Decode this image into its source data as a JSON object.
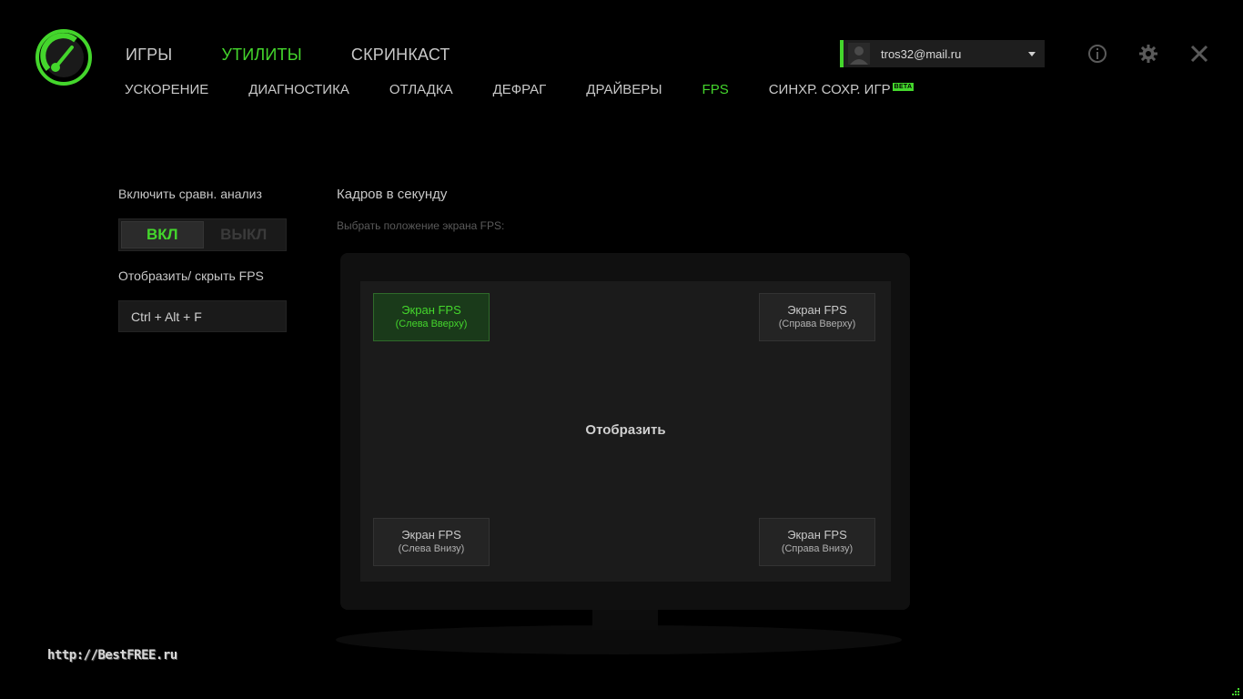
{
  "main_nav": {
    "games": "ИГРЫ",
    "utilities": "УТИЛИТЫ",
    "screencast": "СКРИНКАСТ"
  },
  "sub_nav": {
    "boost": "УСКОРЕНИЕ",
    "diagnostics": "ДИАГНОСТИКА",
    "debug": "ОТЛАДКА",
    "defrag": "ДЕФРАГ",
    "drivers": "ДРАЙВЕРЫ",
    "fps": "FPS",
    "save_sync": "СИНХР. СОХР. ИГР",
    "beta_badge": "BETA"
  },
  "account": {
    "email": "tros32@mail.ru"
  },
  "benchmark": {
    "label": "Включить сравн. анализ",
    "on": "ВКЛ",
    "off": "ВЫКЛ",
    "selected": "on"
  },
  "hotkey": {
    "label": "Отобразить/ скрыть FPS",
    "value": "Ctrl + Alt + F"
  },
  "fps_panel": {
    "title": "Кадров в секунду",
    "subtitle": "Выбрать положение экрана FPS:",
    "show_label": "Отобразить",
    "positions": {
      "top_left": {
        "line1": "Экран FPS",
        "line2": "(Слева Вверху)"
      },
      "top_right": {
        "line1": "Экран FPS",
        "line2": "(Справа Вверху)"
      },
      "bottom_left": {
        "line1": "Экран FPS",
        "line2": "(Слева Внизу)"
      },
      "bottom_right": {
        "line1": "Экран FPS",
        "line2": "(Справа Внизу)"
      }
    },
    "selected_position": "top_left"
  },
  "watermark": "http://BestFREE.ru",
  "colors": {
    "accent": "#44d62c",
    "background": "#000000",
    "text": "#c8c8c8"
  }
}
